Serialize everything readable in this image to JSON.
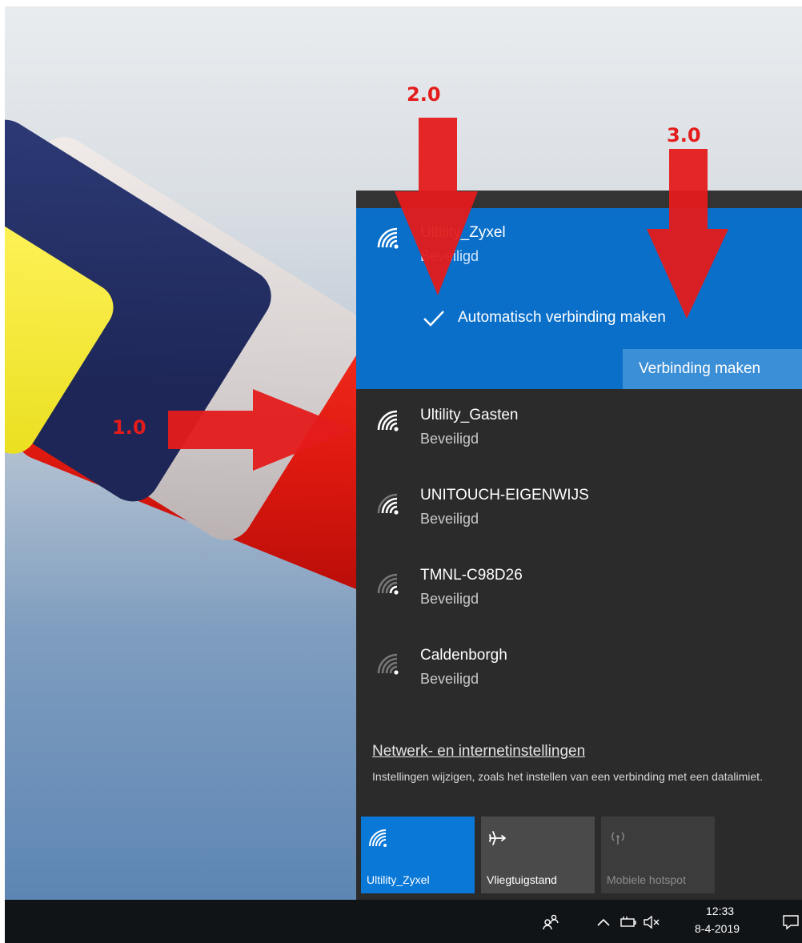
{
  "selected_network": {
    "name": "Ultility_Zyxel",
    "status": "Beveiligd",
    "auto_connect_label": "Automatisch verbinding maken",
    "auto_connect_checked": true,
    "connect_button_label": "Verbinding maken"
  },
  "networks": [
    {
      "name": "Ultility_Gasten",
      "status": "Beveiligd"
    },
    {
      "name": "UNITOUCH-EIGENWIJS",
      "status": "Beveiligd"
    },
    {
      "name": "TMNL-C98D26",
      "status": "Beveiligd"
    },
    {
      "name": "Caldenborgh",
      "status": "Beveiligd"
    }
  ],
  "settings": {
    "link": "Netwerk- en internetinstellingen",
    "description": "Instellingen wijzigen, zoals het instellen van een verbinding met een datalimiet."
  },
  "quick_actions": [
    {
      "label": "Ultility_Zyxel",
      "icon": "wifi-icon",
      "active": true
    },
    {
      "label": "Vliegtuigstand",
      "icon": "airplane-icon",
      "active": false
    },
    {
      "label": "Mobiele hotspot",
      "icon": "hotspot-icon",
      "active": false
    }
  ],
  "taskbar": {
    "time": "12:33",
    "date": "8-4-2019"
  },
  "annotations": {
    "step1": "1.0",
    "step2": "2.0",
    "step3": "3.0"
  },
  "colors": {
    "accent": "#0a6fc9",
    "flyout_bg": "#2b2b2b",
    "annotation_red": "#e41b1b"
  }
}
